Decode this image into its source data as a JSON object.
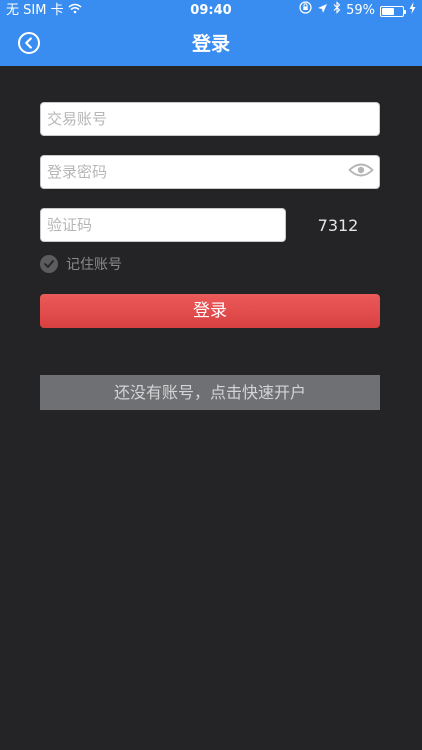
{
  "status_bar": {
    "carrier": "无 SIM 卡",
    "time": "09:40",
    "battery": "59%"
  },
  "nav": {
    "title": "登录"
  },
  "form": {
    "account_placeholder": "交易账号",
    "password_placeholder": "登录密码",
    "captcha_placeholder": "验证码",
    "captcha_code": "7312",
    "remember_label": "记住账号",
    "remember_checked": true
  },
  "buttons": {
    "login": "登录",
    "register": "还没有账号，点击快速开户"
  },
  "colors": {
    "nav_bar": "#3a8df0",
    "background": "#242426",
    "login_button": "#e04b4b",
    "register_button": "#6f7074"
  }
}
